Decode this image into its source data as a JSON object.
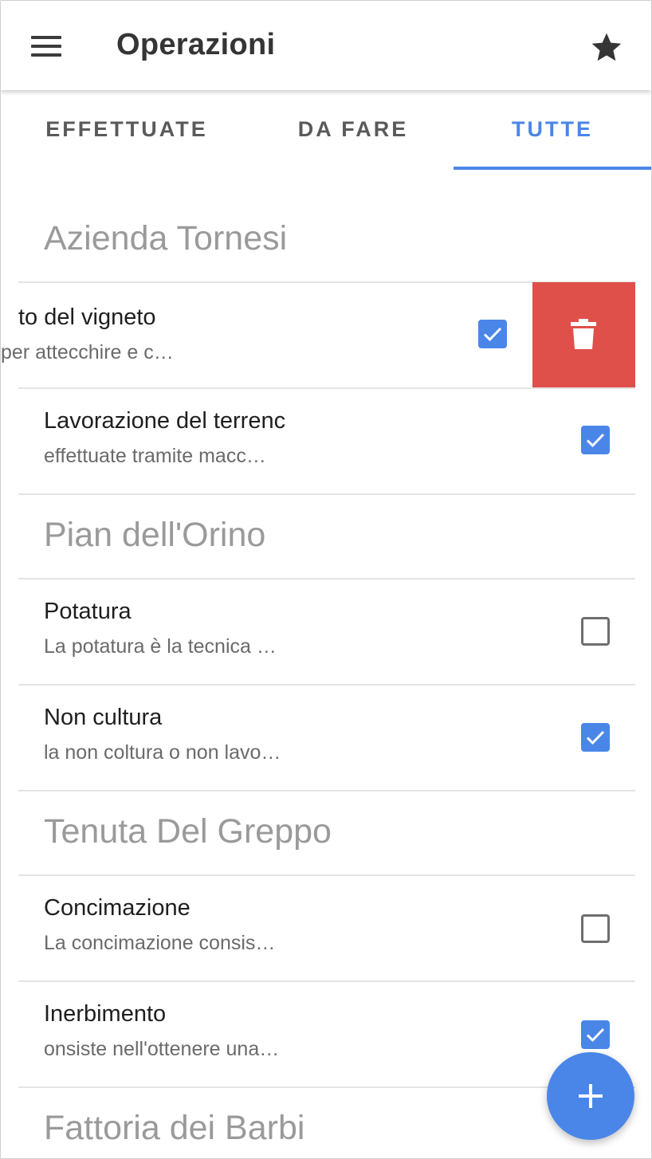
{
  "app_bar": {
    "title": "Operazioni",
    "menu_icon": "hamburger-menu-icon",
    "star_icon": "star-icon"
  },
  "tabs": [
    {
      "label": "EFFETTUATE",
      "active": false
    },
    {
      "label": "DA FARE",
      "active": false
    },
    {
      "label": "TUTTE",
      "active": true
    }
  ],
  "colors": {
    "accent": "#4a86e8",
    "delete": "#e0504a",
    "section_header": "#9a9a9a"
  },
  "sections": [
    {
      "name": "Azienda Tornesi",
      "items": [
        {
          "title": "to del vigneto",
          "subtitle": "per attecchire e c…",
          "checked": true,
          "swiped": true
        },
        {
          "title": "Lavorazione del terrenc",
          "subtitle": "effettuate tramite macc…",
          "checked": true
        }
      ]
    },
    {
      "name": "Pian dell'Orino",
      "items": [
        {
          "title": "Potatura",
          "subtitle": "La potatura è la tecnica …",
          "checked": false
        },
        {
          "title": "Non cultura",
          "subtitle": "la non coltura o non lavo…",
          "checked": true
        }
      ]
    },
    {
      "name": "Tenuta Del Greppo",
      "items": [
        {
          "title": "Concimazione",
          "subtitle": "La concimazione consis…",
          "checked": false
        },
        {
          "title": "Inerbimento",
          "subtitle": "onsiste nell'ottenere una…",
          "checked": true
        }
      ]
    },
    {
      "name": "Fattoria dei Barbi",
      "items": []
    }
  ],
  "swipe_action_icon": "trash-icon",
  "fab_icon": "plus-icon"
}
